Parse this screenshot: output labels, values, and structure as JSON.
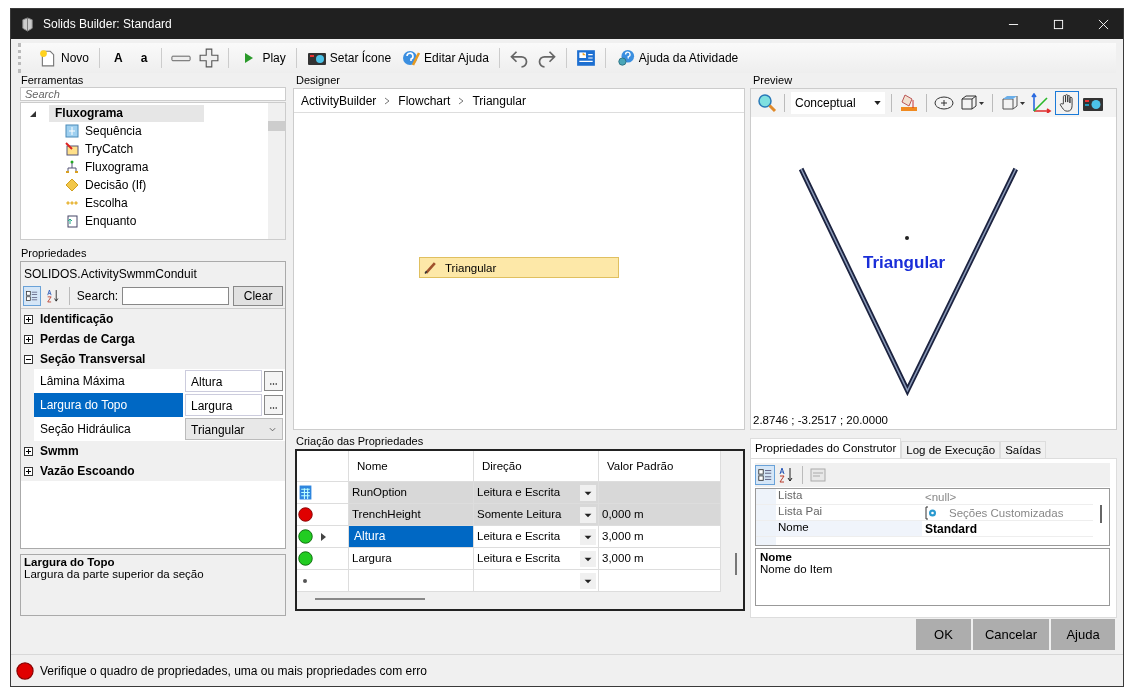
{
  "window": {
    "title": "Solids Builder: Standard"
  },
  "toolbar": {
    "new": "Novo",
    "font_large": "A",
    "font_small": "a",
    "play": "Play",
    "set_icon": "Setar Ícone",
    "edit_help": "Editar Ajuda",
    "activity_help": "Ajuda da Atividade"
  },
  "tools": {
    "title": "Ferramentas",
    "search_placeholder": "Search",
    "tree": [
      {
        "label": "Fluxograma",
        "expanded": true,
        "children": [
          {
            "label": "Sequência"
          },
          {
            "label": "TryCatch"
          },
          {
            "label": "Fluxograma"
          },
          {
            "label": "Decisão (If)"
          },
          {
            "label": "Escolha"
          },
          {
            "label": "Enquanto"
          }
        ]
      }
    ]
  },
  "properties": {
    "title": "Propriedades",
    "object": "SOLIDOS.ActivitySwmmConduit",
    "search_label": "Search:",
    "clear": "Clear",
    "categories": [
      {
        "label": "Identificação",
        "expanded": false
      },
      {
        "label": "Perdas de Carga",
        "expanded": false
      },
      {
        "label": "Seção Transversal",
        "expanded": true,
        "rows": [
          {
            "name": "Lâmina Máxima",
            "value": "Altura",
            "kind": "ellipsis",
            "selected": false
          },
          {
            "name": "Largura do Topo",
            "value": "Largura",
            "kind": "ellipsis",
            "selected": true
          },
          {
            "name": "Seção Hidráulica",
            "value": "Triangular",
            "kind": "dropdown",
            "selected": false
          }
        ]
      },
      {
        "label": "Swmm",
        "expanded": false
      },
      {
        "label": "Vazão Escoando",
        "expanded": false
      }
    ],
    "description": {
      "title": "Largura do Topo",
      "text": "Largura da parte superior da seção"
    }
  },
  "designer": {
    "title": "Designer",
    "breadcrumb": [
      "ActivityBuilder",
      "Flowchart",
      "Triangular"
    ],
    "activity": "Triangular"
  },
  "creation": {
    "title": "Criação das Propriedades",
    "columns": [
      "Nome",
      "Direção",
      "Valor Padrão"
    ],
    "rows": [
      {
        "kind": "table",
        "name": "RunOption",
        "direction": "Leitura e Escrita",
        "value": "",
        "shaded": true,
        "selected": false
      },
      {
        "kind": "error",
        "name": "TrenchHeight",
        "direction": "Somente Leitura",
        "value": "0,000 m",
        "shaded": true,
        "selected": false
      },
      {
        "kind": "ok",
        "name": "Altura",
        "direction": "Leitura e Escrita",
        "value": "3,000 m",
        "shaded": false,
        "selected": true
      },
      {
        "kind": "ok",
        "name": "Largura",
        "direction": "Leitura e Escrita",
        "value": "3,000 m",
        "shaded": false,
        "selected": false
      },
      {
        "kind": "new",
        "name": "",
        "direction": "",
        "value": "",
        "shaded": false,
        "selected": false
      }
    ]
  },
  "preview": {
    "title": "Preview",
    "render_mode": "Conceptual",
    "shape_label": "Triangular",
    "coordinates": "2.8746 ; -3.2517 ; 20.0000"
  },
  "builder": {
    "tabs": [
      {
        "label": "Propriedades do Construtor",
        "selected": true
      },
      {
        "label": "Log de Execução",
        "selected": false
      },
      {
        "label": "Saídas",
        "selected": false
      }
    ],
    "rows": [
      {
        "name": "Lista",
        "value": "<null>",
        "kind": "null",
        "selected": false
      },
      {
        "name": "Lista Pai",
        "value": "Seções Customizadas",
        "kind": "link",
        "selected": false
      },
      {
        "name": "Nome",
        "value": "Standard",
        "kind": "bold",
        "selected": true
      }
    ],
    "description": {
      "title": "Nome",
      "text": "Nome do Item"
    }
  },
  "buttons": [
    "OK",
    "Cancelar",
    "Ajuda"
  ],
  "status_bar": {
    "kind": "error",
    "message": "Verifique o quadro de propriedades, uma ou mais propriedades com erro"
  }
}
